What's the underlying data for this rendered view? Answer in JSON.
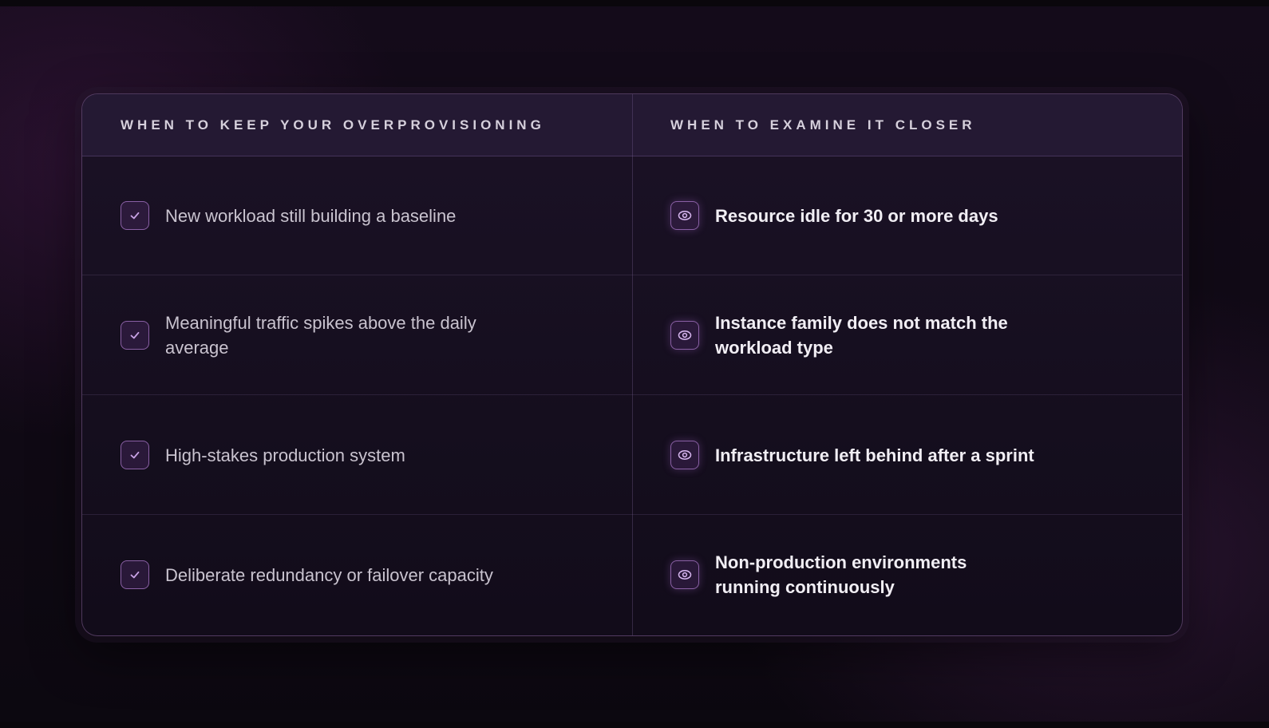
{
  "table": {
    "headers": {
      "left": "WHEN TO KEEP YOUR OVERPROVISIONING",
      "right": "WHEN TO EXAMINE IT CLOSER"
    },
    "rows": [
      {
        "left": {
          "icon": "check-icon",
          "text": "New workload still building a baseline"
        },
        "right": {
          "icon": "eye-icon",
          "text": "Resource idle for 30 or more days"
        }
      },
      {
        "left": {
          "icon": "check-icon",
          "text": "Meaningful traffic spikes above the daily average"
        },
        "right": {
          "icon": "eye-icon",
          "text": "Instance family does not match the workload type"
        }
      },
      {
        "left": {
          "icon": "check-icon",
          "text": "High-stakes production system"
        },
        "right": {
          "icon": "eye-icon",
          "text": "Infrastructure left behind after a sprint"
        }
      },
      {
        "left": {
          "icon": "check-icon",
          "text": "Deliberate redundancy or failover capacity"
        },
        "right": {
          "icon": "eye-icon",
          "text": "Non-production environments running continuously"
        }
      }
    ]
  },
  "colors": {
    "accent": "#b488d8",
    "card_border": "#966eaa",
    "background": "#140b1a"
  }
}
